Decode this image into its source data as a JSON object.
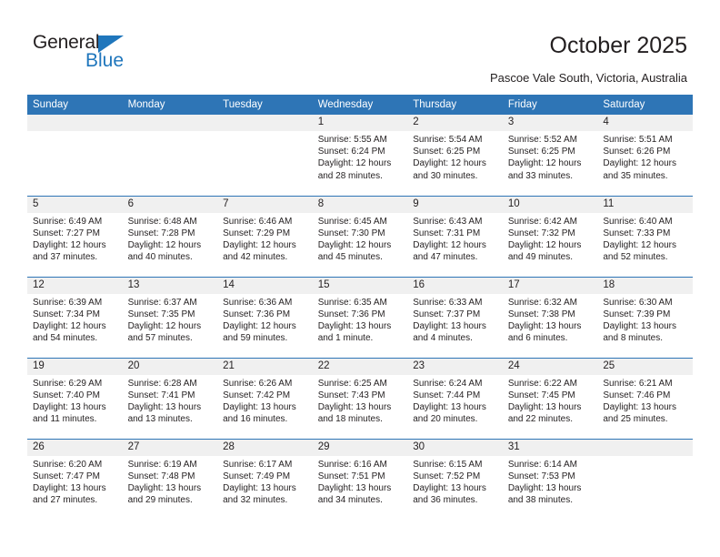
{
  "brand": {
    "name_part1": "General",
    "name_part2": "Blue",
    "triangle_color": "#1f76bc"
  },
  "header": {
    "month_title": "October 2025",
    "location": "Pascoe Vale South, Victoria, Australia"
  },
  "theme": {
    "header_blue": "#2e75b6",
    "daynum_gray": "#f0f0f0",
    "text_color": "#231f20"
  },
  "calendar": {
    "weekday_headers": [
      "Sunday",
      "Monday",
      "Tuesday",
      "Wednesday",
      "Thursday",
      "Friday",
      "Saturday"
    ],
    "labels": {
      "sunrise_prefix": "Sunrise:",
      "sunset_prefix": "Sunset:",
      "daylight_prefix": "Daylight:"
    },
    "weeks": [
      [
        {
          "day": "",
          "empty": true
        },
        {
          "day": "",
          "empty": true
        },
        {
          "day": "",
          "empty": true
        },
        {
          "day": "1",
          "sunrise": "Sunrise: 5:55 AM",
          "sunset": "Sunset: 6:24 PM",
          "daylight": "Daylight: 12 hours and 28 minutes."
        },
        {
          "day": "2",
          "sunrise": "Sunrise: 5:54 AM",
          "sunset": "Sunset: 6:25 PM",
          "daylight": "Daylight: 12 hours and 30 minutes."
        },
        {
          "day": "3",
          "sunrise": "Sunrise: 5:52 AM",
          "sunset": "Sunset: 6:25 PM",
          "daylight": "Daylight: 12 hours and 33 minutes."
        },
        {
          "day": "4",
          "sunrise": "Sunrise: 5:51 AM",
          "sunset": "Sunset: 6:26 PM",
          "daylight": "Daylight: 12 hours and 35 minutes."
        }
      ],
      [
        {
          "day": "5",
          "sunrise": "Sunrise: 6:49 AM",
          "sunset": "Sunset: 7:27 PM",
          "daylight": "Daylight: 12 hours and 37 minutes."
        },
        {
          "day": "6",
          "sunrise": "Sunrise: 6:48 AM",
          "sunset": "Sunset: 7:28 PM",
          "daylight": "Daylight: 12 hours and 40 minutes."
        },
        {
          "day": "7",
          "sunrise": "Sunrise: 6:46 AM",
          "sunset": "Sunset: 7:29 PM",
          "daylight": "Daylight: 12 hours and 42 minutes."
        },
        {
          "day": "8",
          "sunrise": "Sunrise: 6:45 AM",
          "sunset": "Sunset: 7:30 PM",
          "daylight": "Daylight: 12 hours and 45 minutes."
        },
        {
          "day": "9",
          "sunrise": "Sunrise: 6:43 AM",
          "sunset": "Sunset: 7:31 PM",
          "daylight": "Daylight: 12 hours and 47 minutes."
        },
        {
          "day": "10",
          "sunrise": "Sunrise: 6:42 AM",
          "sunset": "Sunset: 7:32 PM",
          "daylight": "Daylight: 12 hours and 49 minutes."
        },
        {
          "day": "11",
          "sunrise": "Sunrise: 6:40 AM",
          "sunset": "Sunset: 7:33 PM",
          "daylight": "Daylight: 12 hours and 52 minutes."
        }
      ],
      [
        {
          "day": "12",
          "sunrise": "Sunrise: 6:39 AM",
          "sunset": "Sunset: 7:34 PM",
          "daylight": "Daylight: 12 hours and 54 minutes."
        },
        {
          "day": "13",
          "sunrise": "Sunrise: 6:37 AM",
          "sunset": "Sunset: 7:35 PM",
          "daylight": "Daylight: 12 hours and 57 minutes."
        },
        {
          "day": "14",
          "sunrise": "Sunrise: 6:36 AM",
          "sunset": "Sunset: 7:36 PM",
          "daylight": "Daylight: 12 hours and 59 minutes."
        },
        {
          "day": "15",
          "sunrise": "Sunrise: 6:35 AM",
          "sunset": "Sunset: 7:36 PM",
          "daylight": "Daylight: 13 hours and 1 minute."
        },
        {
          "day": "16",
          "sunrise": "Sunrise: 6:33 AM",
          "sunset": "Sunset: 7:37 PM",
          "daylight": "Daylight: 13 hours and 4 minutes."
        },
        {
          "day": "17",
          "sunrise": "Sunrise: 6:32 AM",
          "sunset": "Sunset: 7:38 PM",
          "daylight": "Daylight: 13 hours and 6 minutes."
        },
        {
          "day": "18",
          "sunrise": "Sunrise: 6:30 AM",
          "sunset": "Sunset: 7:39 PM",
          "daylight": "Daylight: 13 hours and 8 minutes."
        }
      ],
      [
        {
          "day": "19",
          "sunrise": "Sunrise: 6:29 AM",
          "sunset": "Sunset: 7:40 PM",
          "daylight": "Daylight: 13 hours and 11 minutes."
        },
        {
          "day": "20",
          "sunrise": "Sunrise: 6:28 AM",
          "sunset": "Sunset: 7:41 PM",
          "daylight": "Daylight: 13 hours and 13 minutes."
        },
        {
          "day": "21",
          "sunrise": "Sunrise: 6:26 AM",
          "sunset": "Sunset: 7:42 PM",
          "daylight": "Daylight: 13 hours and 16 minutes."
        },
        {
          "day": "22",
          "sunrise": "Sunrise: 6:25 AM",
          "sunset": "Sunset: 7:43 PM",
          "daylight": "Daylight: 13 hours and 18 minutes."
        },
        {
          "day": "23",
          "sunrise": "Sunrise: 6:24 AM",
          "sunset": "Sunset: 7:44 PM",
          "daylight": "Daylight: 13 hours and 20 minutes."
        },
        {
          "day": "24",
          "sunrise": "Sunrise: 6:22 AM",
          "sunset": "Sunset: 7:45 PM",
          "daylight": "Daylight: 13 hours and 22 minutes."
        },
        {
          "day": "25",
          "sunrise": "Sunrise: 6:21 AM",
          "sunset": "Sunset: 7:46 PM",
          "daylight": "Daylight: 13 hours and 25 minutes."
        }
      ],
      [
        {
          "day": "26",
          "sunrise": "Sunrise: 6:20 AM",
          "sunset": "Sunset: 7:47 PM",
          "daylight": "Daylight: 13 hours and 27 minutes."
        },
        {
          "day": "27",
          "sunrise": "Sunrise: 6:19 AM",
          "sunset": "Sunset: 7:48 PM",
          "daylight": "Daylight: 13 hours and 29 minutes."
        },
        {
          "day": "28",
          "sunrise": "Sunrise: 6:17 AM",
          "sunset": "Sunset: 7:49 PM",
          "daylight": "Daylight: 13 hours and 32 minutes."
        },
        {
          "day": "29",
          "sunrise": "Sunrise: 6:16 AM",
          "sunset": "Sunset: 7:51 PM",
          "daylight": "Daylight: 13 hours and 34 minutes."
        },
        {
          "day": "30",
          "sunrise": "Sunrise: 6:15 AM",
          "sunset": "Sunset: 7:52 PM",
          "daylight": "Daylight: 13 hours and 36 minutes."
        },
        {
          "day": "31",
          "sunrise": "Sunrise: 6:14 AM",
          "sunset": "Sunset: 7:53 PM",
          "daylight": "Daylight: 13 hours and 38 minutes."
        },
        {
          "day": "",
          "empty": true
        }
      ]
    ]
  }
}
